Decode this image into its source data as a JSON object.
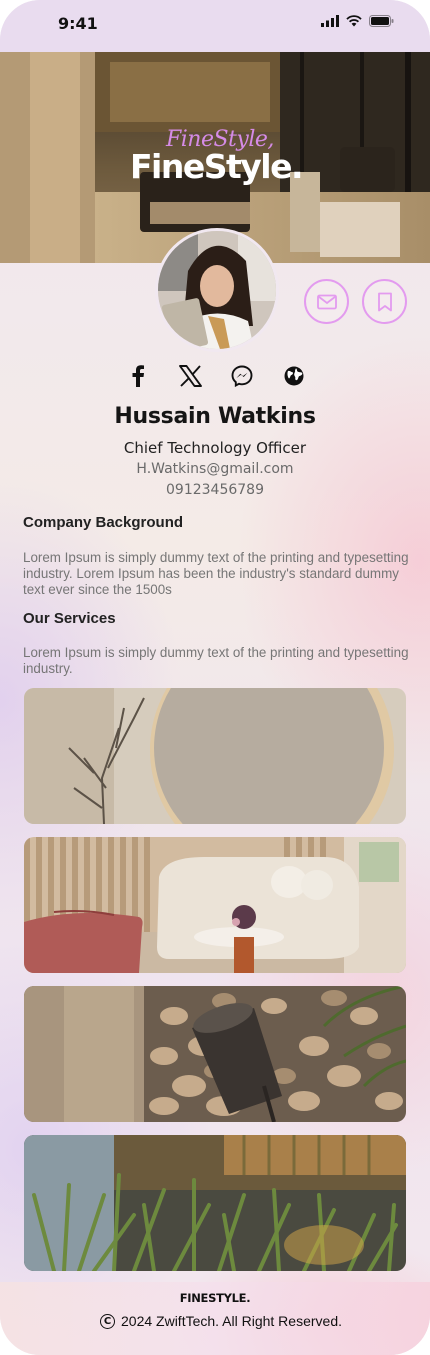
{
  "status_bar": {
    "time": "9:41"
  },
  "hero": {
    "brand_script": "FineStyle,",
    "brand_main": "FineStyle."
  },
  "profile": {
    "name": "Hussain Watkins",
    "role": "Chief Technology Officer",
    "email": "H.Watkins@gmail.com",
    "phone": "09123456789"
  },
  "actions": [
    {
      "icon": "mail-icon"
    },
    {
      "icon": "bookmark-icon"
    }
  ],
  "socials": [
    {
      "icon": "facebook-icon"
    },
    {
      "icon": "x-icon"
    },
    {
      "icon": "messenger-icon"
    },
    {
      "icon": "globe-icon"
    }
  ],
  "company": {
    "title": "Company Background",
    "text": "Lorem Ipsum is simply dummy text of the printing and typesetting industry. Lorem Ipsum has been the industry's standard dummy text ever since the 1500s"
  },
  "services": {
    "title": "Our Services",
    "text": "Lorem Ipsum is simply dummy text of the printing and typesetting industry.",
    "images": [
      "arch-wall-branch",
      "lounge-sofa",
      "garden-spotlight",
      "plants-evening"
    ]
  },
  "footer": {
    "brand": "FINESTYLE.",
    "copyright": "2024 ZwiftTech. All Right Reserved."
  },
  "colors": {
    "accent": "#e39bef",
    "text": "#151515",
    "muted": "#767676"
  }
}
